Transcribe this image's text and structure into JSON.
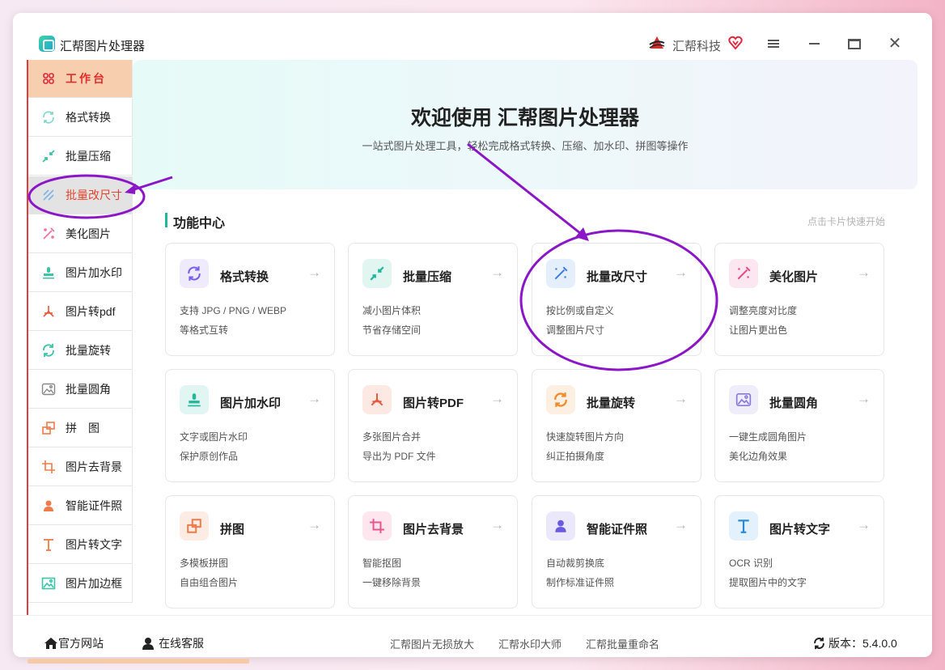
{
  "window": {
    "app_title": "汇帮图片处理器",
    "brand_name": "汇帮科技"
  },
  "sidebar": {
    "items": [
      {
        "label": "工作台",
        "icon": "workbench-icon"
      },
      {
        "label": "格式转换",
        "icon": "format-convert-icon"
      },
      {
        "label": "批量压缩",
        "icon": "compress-icon"
      },
      {
        "label": "批量改尺寸",
        "icon": "resize-icon"
      },
      {
        "label": "美化图片",
        "icon": "beautify-icon"
      },
      {
        "label": "图片加水印",
        "icon": "watermark-icon"
      },
      {
        "label": "图片转pdf",
        "icon": "pdf-icon"
      },
      {
        "label": "批量旋转",
        "icon": "rotate-icon"
      },
      {
        "label": "批量圆角",
        "icon": "round-corner-icon"
      },
      {
        "label": "拼　图",
        "icon": "collage-icon"
      },
      {
        "label": "图片去背景",
        "icon": "remove-bg-icon"
      },
      {
        "label": "智能证件照",
        "icon": "id-photo-icon"
      },
      {
        "label": "图片转文字",
        "icon": "ocr-icon"
      },
      {
        "label": "图片加边框",
        "icon": "border-icon"
      }
    ]
  },
  "hero": {
    "title": "欢迎使用 汇帮图片处理器",
    "subtitle": "一站式图片处理工具，轻松完成格式转换、压缩、加水印、拼图等操作"
  },
  "section": {
    "title": "功能中心",
    "hint": "点击卡片快速开始"
  },
  "cards": [
    {
      "title": "格式转换",
      "line1": "支持 JPG / PNG / WEBP",
      "line2": "等格式互转",
      "arrow": "→",
      "color": "#7a5cf0"
    },
    {
      "title": "批量压缩",
      "line1": "减小图片体积",
      "line2": "节省存储空间",
      "arrow": "→",
      "color": "#1fb99a"
    },
    {
      "title": "批量改尺寸",
      "line1": "按比例或自定义",
      "line2": "调整图片尺寸",
      "arrow": "→",
      "color": "#3a7be8"
    },
    {
      "title": "美化图片",
      "line1": "调整亮度对比度",
      "line2": "让图片更出色",
      "arrow": "→",
      "color": "#e8468a"
    },
    {
      "title": "图片加水印",
      "line1": "文字或图片水印",
      "line2": "保护原创作品",
      "arrow": "→",
      "color": "#1fb99a"
    },
    {
      "title": "图片转PDF",
      "line1": "多张图片合并",
      "line2": "导出为 PDF 文件",
      "arrow": "→",
      "color": "#e85a3a"
    },
    {
      "title": "批量旋转",
      "line1": "快速旋转图片方向",
      "line2": "纠正拍摄角度",
      "arrow": "→",
      "color": "#f08a2a"
    },
    {
      "title": "批量圆角",
      "line1": "一键生成圆角图片",
      "line2": "美化边角效果",
      "arrow": "→",
      "color": "#8a7ad8"
    },
    {
      "title": "拼图",
      "line1": "多模板拼图",
      "line2": "自由组合图片",
      "arrow": "→",
      "color": "#f07a4a"
    },
    {
      "title": "图片去背景",
      "line1": "智能抠图",
      "line2": "一键移除背景",
      "arrow": "→",
      "color": "#e8568a"
    },
    {
      "title": "智能证件照",
      "line1": "自动裁剪换底",
      "line2": "制作标准证件照",
      "arrow": "→",
      "color": "#6a5ae0"
    },
    {
      "title": "图片转文字",
      "line1": "OCR 识别",
      "line2": "提取图片中的文字",
      "arrow": "→",
      "color": "#2a8ad8"
    }
  ],
  "footer": {
    "website": "官方网站",
    "service": "在线客服",
    "links": [
      "汇帮图片无损放大",
      "汇帮水印大师",
      "汇帮批量重命名"
    ],
    "version": "版本：5.4.0.0"
  }
}
